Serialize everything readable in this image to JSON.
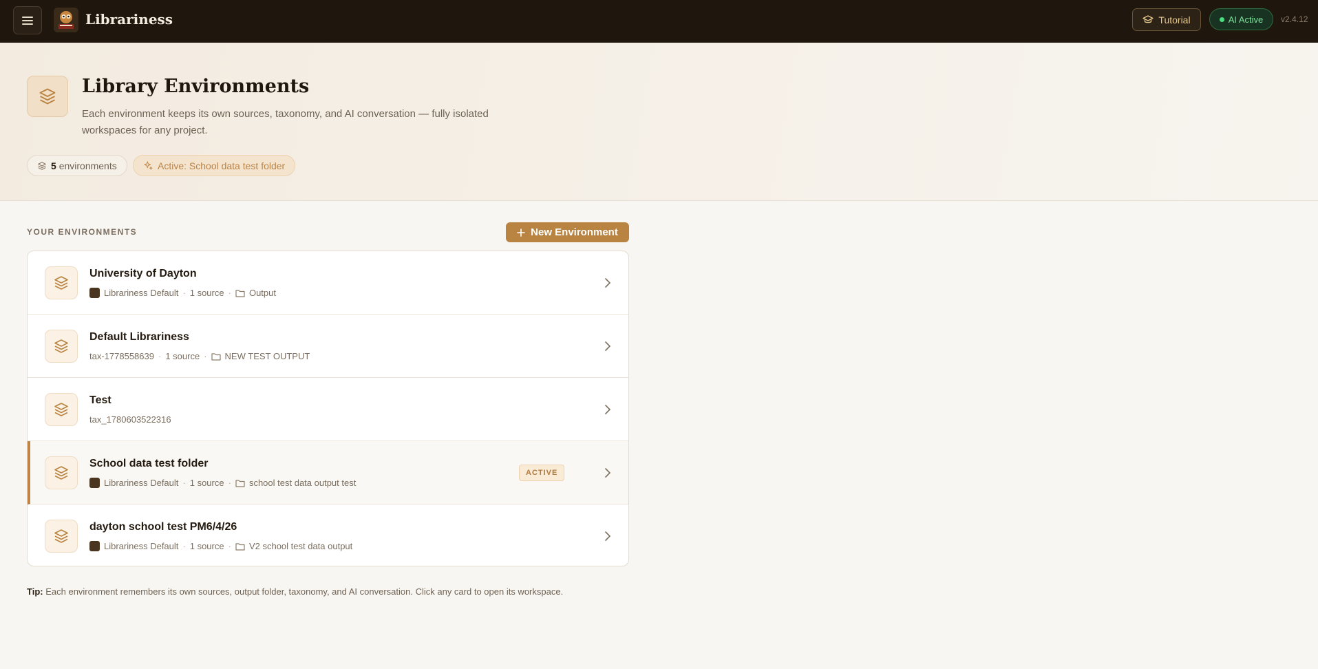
{
  "header": {
    "app_name": "Librariness",
    "tutorial_label": "Tutorial",
    "ai_status_label": "AI Active",
    "version": "v2.4.12"
  },
  "hero": {
    "title": "Library Environments",
    "description": "Each environment keeps its own sources, taxonomy, and AI conversation — fully isolated workspaces for any project.",
    "count_number": "5",
    "count_label": "environments",
    "active_label": "Active: School data test folder"
  },
  "section": {
    "label": "YOUR ENVIRONMENTS",
    "new_button_label": "New Environment"
  },
  "environments": [
    {
      "name": "University of Dayton",
      "taxonomy": "Librariness Default",
      "sources": "1 source",
      "folder": "Output",
      "active": false
    },
    {
      "name": "Default Librariness",
      "taxonomy": "tax-1778558639",
      "sources": "1 source",
      "folder": "NEW TEST OUTPUT",
      "active": false
    },
    {
      "name": "Test",
      "taxonomy": "tax_1780603522316",
      "sources": "",
      "folder": "",
      "active": false
    },
    {
      "name": "School data test folder",
      "taxonomy": "Librariness Default",
      "sources": "1 source",
      "folder": "school test data output test",
      "active": true
    },
    {
      "name": "dayton school test PM6/4/26",
      "taxonomy": "Librariness Default",
      "sources": "1 source",
      "folder": "V2 school test data output",
      "active": false
    }
  ],
  "active_badge_label": "ACTIVE",
  "tip": {
    "prefix": "Tip:",
    "text": "Each environment remembers its own sources, output folder, taxonomy, and AI conversation. Click any card to open its workspace."
  },
  "colors": {
    "topbar": "#1f170e",
    "accent": "#b98341",
    "ai_green": "#4ade80"
  }
}
